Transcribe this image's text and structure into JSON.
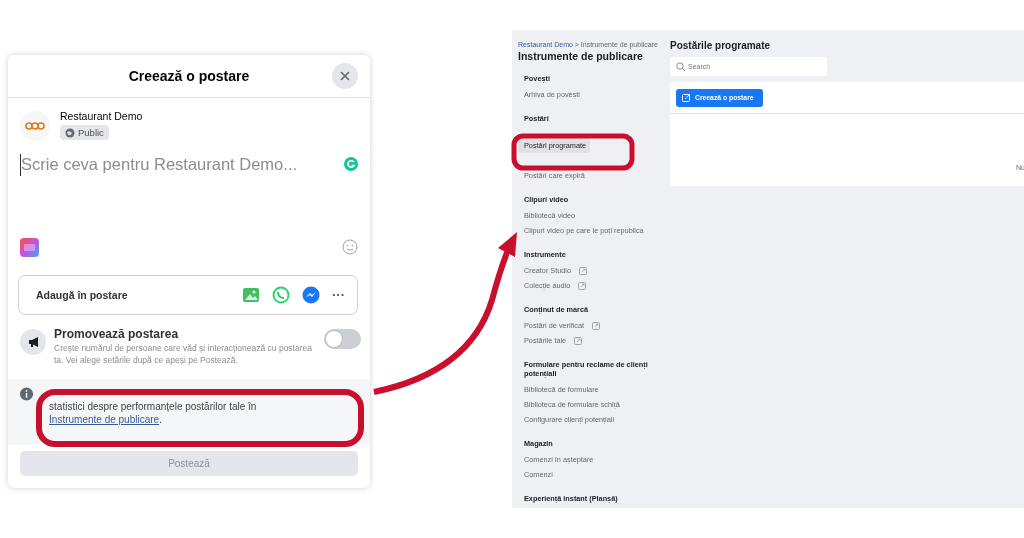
{
  "dialog": {
    "title": "Creează o postare",
    "page_name": "Restaurant Demo",
    "audience": "Public",
    "composer": {
      "placeholder": "Scrie ceva pentru Restaurant Demo..."
    },
    "add_to_post": {
      "label": "Adaugă în postare",
      "more": "···"
    },
    "promote": {
      "title": "Promovează postarea",
      "description": "Crește numărul de persoane care văd și interacționează cu postarea ta. Vei alege setările după ce apeși pe Postează.",
      "on": false
    },
    "info": {
      "text": "statistici despre performanțele postărilor tale în ",
      "link": "Instrumente de publicare",
      "end": "."
    },
    "post_button": {
      "label": "Postează",
      "disabled": true
    }
  },
  "publishing_tools": {
    "breadcrumb": {
      "link": "Restaurant Demo",
      "rest": "> Instrumente de publicare"
    },
    "title": "Instrumente de publicare",
    "sections": [
      {
        "heading": "Povești",
        "items": [
          {
            "label": "Arhiva de povești",
            "external": false,
            "selected": false
          }
        ]
      },
      {
        "heading": "Postări",
        "items": [
          {
            "label": "Postări programate",
            "external": false,
            "selected": true
          },
          {
            "label": "Postări care expiră",
            "external": false,
            "selected": false
          }
        ]
      },
      {
        "heading": "Clipuri video",
        "items": [
          {
            "label": "Bibliotecă video",
            "external": false,
            "selected": false
          },
          {
            "label": "Clipuri video pe care le poți republica",
            "external": false,
            "selected": false
          }
        ]
      },
      {
        "heading": "Instrumente",
        "items": [
          {
            "label": "Creator Studio",
            "external": true,
            "selected": false
          },
          {
            "label": "Colecție audio",
            "external": true,
            "selected": false
          }
        ]
      },
      {
        "heading": "Conținut de marcă",
        "items": [
          {
            "label": "Postări de verificat",
            "external": true,
            "selected": false
          },
          {
            "label": "Postările tale",
            "external": true,
            "selected": false
          }
        ]
      },
      {
        "heading": "Formulare pentru reclame de clienți potențiali",
        "items": [
          {
            "label": "Bibliotecă de formulare",
            "external": false,
            "selected": false
          },
          {
            "label": "Biblioteca de formulare schiță",
            "external": false,
            "selected": false
          },
          {
            "label": "Configurare clienți potențiali",
            "external": false,
            "selected": false
          }
        ]
      },
      {
        "heading": "Magazin",
        "items": [
          {
            "label": "Comenzi în așteptare",
            "external": false,
            "selected": false
          },
          {
            "label": "Comenzi",
            "external": false,
            "selected": false
          }
        ]
      },
      {
        "heading": "Experiență instant (Planșă)"
      }
    ],
    "main": {
      "title": "Postările programate",
      "search": {
        "placeholder": "Search"
      },
      "create_button": "Creează o postare",
      "column_1": "Nu"
    }
  }
}
